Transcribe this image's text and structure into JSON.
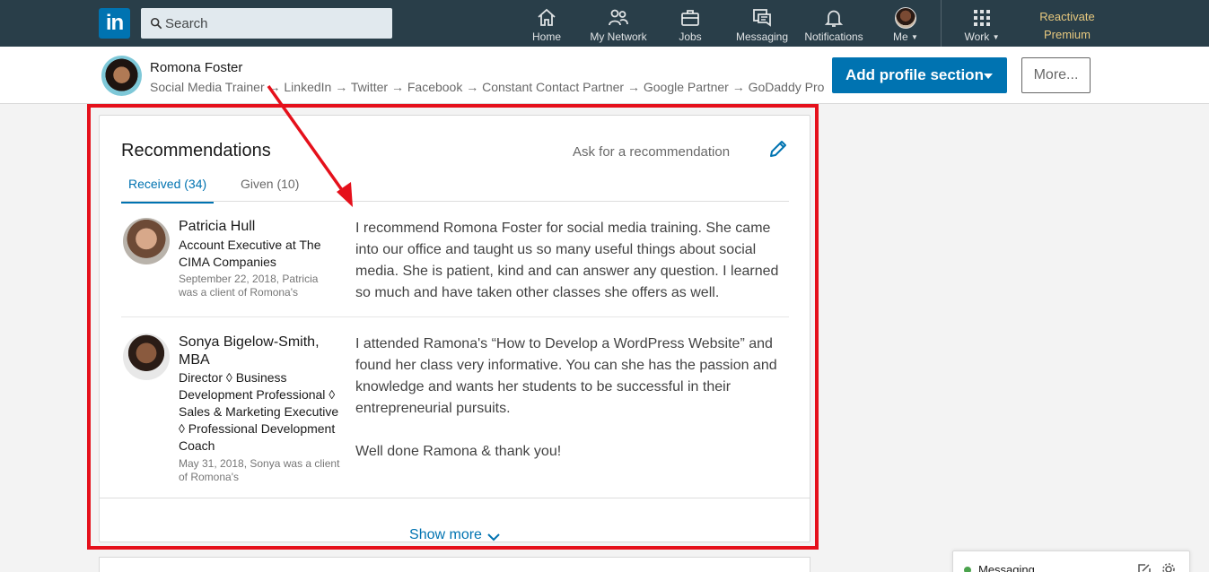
{
  "nav": {
    "logo": "in",
    "search_placeholder": "Search",
    "items": [
      {
        "label": "Home",
        "icon": "home-icon"
      },
      {
        "label": "My Network",
        "icon": "network-icon"
      },
      {
        "label": "Jobs",
        "icon": "briefcase-icon"
      },
      {
        "label": "Messaging",
        "icon": "messaging-icon"
      },
      {
        "label": "Notifications",
        "icon": "bell-icon"
      }
    ],
    "me_label": "Me",
    "work_label": "Work",
    "premium_line1": "Reactivate",
    "premium_line2": "Premium"
  },
  "profile": {
    "name": "Romona Foster",
    "headline": "Social Media Trainer → LinkedIn → Twitter → Facebook → Constant Contact Partner → Google Partner → GoDaddy Pro",
    "add_section_label": "Add profile section",
    "more_label": "More..."
  },
  "recommendations": {
    "title": "Recommendations",
    "ask_label": "Ask for a recommendation",
    "tabs": [
      {
        "label": "Received (34)",
        "active": true
      },
      {
        "label": "Given (10)",
        "active": false
      }
    ],
    "items": [
      {
        "name": "Patricia Hull",
        "title": "Account Executive at The CIMA Companies",
        "meta": "September 22, 2018, Patricia was a client of Romona's",
        "text": "I recommend Romona Foster for social media training. She came into our office and taught us so many useful things about social media. She is patient, kind and can answer any question. I learned so much and have taken other classes she offers as well."
      },
      {
        "name": "Sonya Bigelow-Smith, MBA",
        "title": "Director ◊ Business Development Professional ◊ Sales & Marketing Executive ◊ Professional Development Coach",
        "meta": "May 31, 2018, Sonya was a client of Romona's",
        "text": "I attended Ramona's “How to Develop a WordPress Website” and found her class very informative. You can she has the passion and knowledge and wants her students to be successful in their entrepreneurial pursuits.\n\nWell done Ramona & thank you!"
      }
    ],
    "show_more_label": "Show more"
  },
  "messaging_dock": {
    "label": "Messaging"
  },
  "colors": {
    "nav_bg": "#293e49",
    "brand_blue": "#0073b1",
    "annotation_red": "#e5101b",
    "premium_gold": "#e7c87e"
  }
}
